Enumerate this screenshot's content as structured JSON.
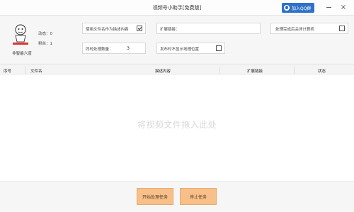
{
  "window": {
    "title": "视频号小助手[免费版]",
    "qq_button_label": "加入QQ群",
    "close_glyph": "×"
  },
  "profile": {
    "author": "非智能六道",
    "stat_dynamic": "动态：0",
    "stat_fans": "粉丝：1"
  },
  "options": {
    "use_filename_label": "使用文件名作为描述内容",
    "use_filename_checked": true,
    "ext_link_label": "扩展链接：",
    "ext_link_value": "",
    "shutdown_label": "处理完成后关闭计算机",
    "shutdown_checked": false,
    "concurrent_label": "同时处理数量：",
    "concurrent_value": "3",
    "hide_location_label": "发布时不显示地理位置",
    "hide_location_checked": false
  },
  "table": {
    "columns": [
      "序号",
      "文件名",
      "描述内容",
      "扩展链接",
      "状态"
    ],
    "empty_hint": "将视频文件拖入此处",
    "rows": []
  },
  "actions": {
    "start_label": "开始处理任务",
    "stop_label": "停止任务"
  },
  "colors": {
    "accent_button": "#f7c08a",
    "qq_button": "#2e72c7"
  }
}
